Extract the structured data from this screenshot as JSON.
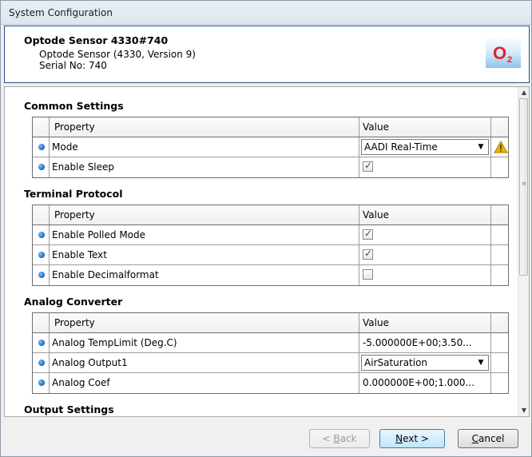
{
  "window": {
    "title": "System Configuration"
  },
  "header": {
    "title": "Optode Sensor 4330#740",
    "line1": "Optode Sensor (4330, Version 9)",
    "line2": "Serial No: 740",
    "logo_text": "O",
    "logo_sub": "2"
  },
  "columns": {
    "property": "Property",
    "value": "Value"
  },
  "sections": [
    {
      "title": "Common Settings",
      "rows": [
        {
          "property": "Mode",
          "value": "AADI Real-Time",
          "type": "combo",
          "warning": true
        },
        {
          "property": "Enable Sleep",
          "type": "checkbox",
          "checked": true
        }
      ]
    },
    {
      "title": "Terminal Protocol",
      "rows": [
        {
          "property": "Enable Polled Mode",
          "type": "checkbox",
          "checked": true
        },
        {
          "property": "Enable Text",
          "type": "checkbox",
          "checked": true
        },
        {
          "property": "Enable Decimalformat",
          "type": "checkbox",
          "checked": false
        }
      ]
    },
    {
      "title": "Analog Converter",
      "rows": [
        {
          "property": "Analog TempLimit (Deg.C)",
          "value": "-5.000000E+00;3.50...",
          "type": "text"
        },
        {
          "property": "Analog Output1",
          "value": "AirSaturation",
          "type": "combo"
        },
        {
          "property": "Analog Coef",
          "value": "0.000000E+00;1.000...",
          "type": "text"
        }
      ]
    },
    {
      "title": "Output Settings",
      "rows": []
    }
  ],
  "buttons": {
    "back": {
      "pre": "< ",
      "u": "B",
      "post": "ack"
    },
    "next": {
      "u": "N",
      "post": "ext >"
    },
    "cancel": {
      "u": "C",
      "post": "ancel"
    }
  },
  "colors": {
    "accent": "#2c4f85",
    "logo_red": "#e8202a",
    "warning": "#f0b400"
  }
}
